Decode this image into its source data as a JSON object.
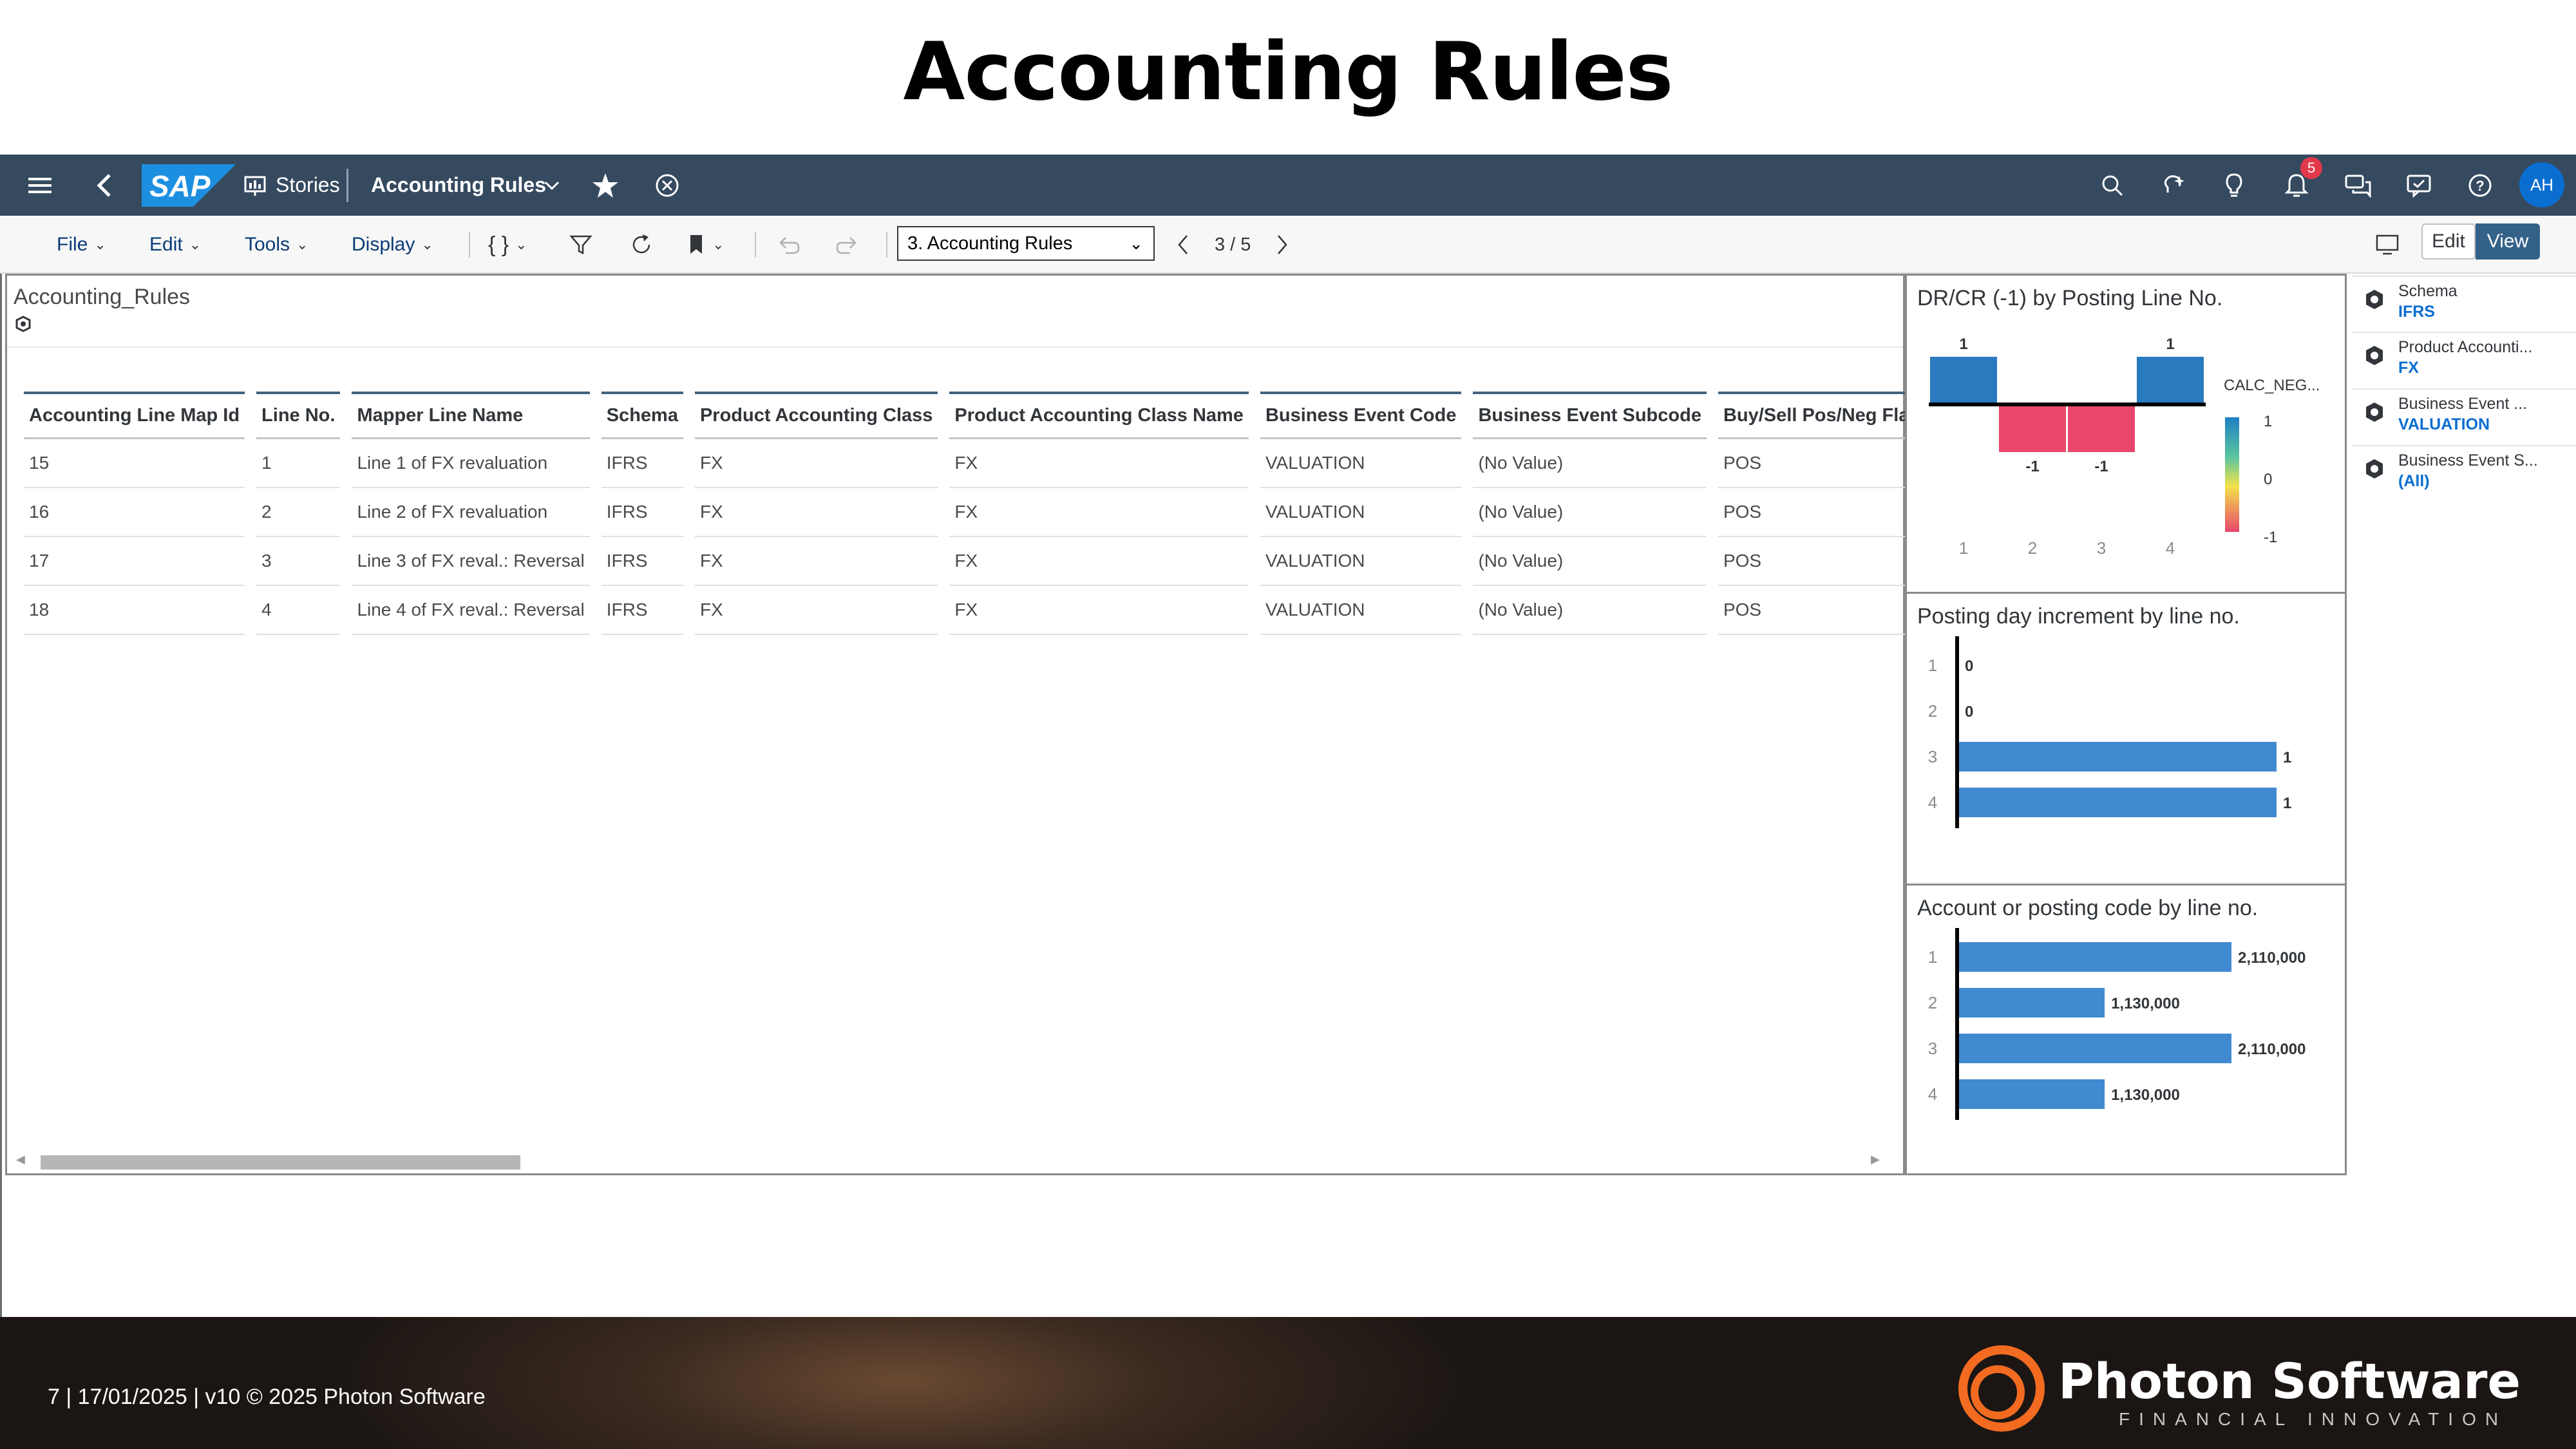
{
  "slide_title": "Accounting Rules",
  "shell": {
    "stories": "Stories",
    "app_title": "Accounting Rules",
    "notification_count": "5",
    "avatar": "AH"
  },
  "toolbar": {
    "file": "File",
    "edit": "Edit",
    "tools": "Tools",
    "display": "Display",
    "page_selected": "3. Accounting Rules",
    "pager": "3 / 5",
    "edit_mode": "Edit",
    "view_mode": "View"
  },
  "table": {
    "title": "Accounting_Rules",
    "columns": [
      "Accounting Line Map Id",
      "Line No.",
      "Mapper Line Name",
      "Schema",
      "Product Accounting Class",
      "Product Accounting Class Name",
      "Business Event Code",
      "Business Event Subcode",
      "Buy/Sell Pos/Neg Flag"
    ],
    "rows": [
      [
        "15",
        "1",
        "Line 1 of FX revaluation",
        "IFRS",
        "FX",
        "FX",
        "VALUATION",
        "(No Value)",
        "POS"
      ],
      [
        "16",
        "2",
        "Line 2 of FX revaluation",
        "IFRS",
        "FX",
        "FX",
        "VALUATION",
        "(No Value)",
        "POS"
      ],
      [
        "17",
        "3",
        "Line 3 of FX reval.: Reversal",
        "IFRS",
        "FX",
        "FX",
        "VALUATION",
        "(No Value)",
        "POS"
      ],
      [
        "18",
        "4",
        "Line 4 of FX reval.: Reversal",
        "IFRS",
        "FX",
        "FX",
        "VALUATION",
        "(No Value)",
        "POS"
      ]
    ]
  },
  "chart_data": [
    {
      "type": "bar",
      "title": "DR/CR (-1) by Posting Line No.",
      "categories": [
        "1",
        "2",
        "3",
        "4"
      ],
      "values": [
        1,
        -1,
        -1,
        1
      ],
      "legend_title": "CALC_NEG...",
      "legend_ticks": [
        "1",
        "0",
        "-1"
      ],
      "colors": {
        "positive": "#2a7ac0",
        "negative": "#e8476b"
      }
    },
    {
      "type": "bar",
      "orientation": "horizontal",
      "title": "Posting day increment by line no.",
      "categories": [
        "1",
        "2",
        "3",
        "4"
      ],
      "values": [
        0,
        0,
        1,
        1
      ],
      "labels": [
        "0",
        "0",
        "1",
        "1"
      ],
      "color": "#4189d0"
    },
    {
      "type": "bar",
      "orientation": "horizontal",
      "title": "Account or posting code by line no.",
      "categories": [
        "1",
        "2",
        "3",
        "4"
      ],
      "values": [
        2110000,
        1130000,
        2110000,
        1130000
      ],
      "labels": [
        "2,110,000",
        "1,130,000",
        "2,110,000",
        "1,130,000"
      ],
      "color": "#4189d0"
    }
  ],
  "filters": [
    {
      "label": "Schema",
      "value": "IFRS"
    },
    {
      "label": "Product Accounti...",
      "value": "FX"
    },
    {
      "label": "Business Event ...",
      "value": "VALUATION"
    },
    {
      "label": "Business Event S...",
      "value": "(All)"
    }
  ],
  "footer": {
    "text": "7  |  17/01/2025 | v10 © 2025 Photon Software",
    "brand": "Photon Software",
    "tagline": "FINANCIAL INNOVATION"
  }
}
